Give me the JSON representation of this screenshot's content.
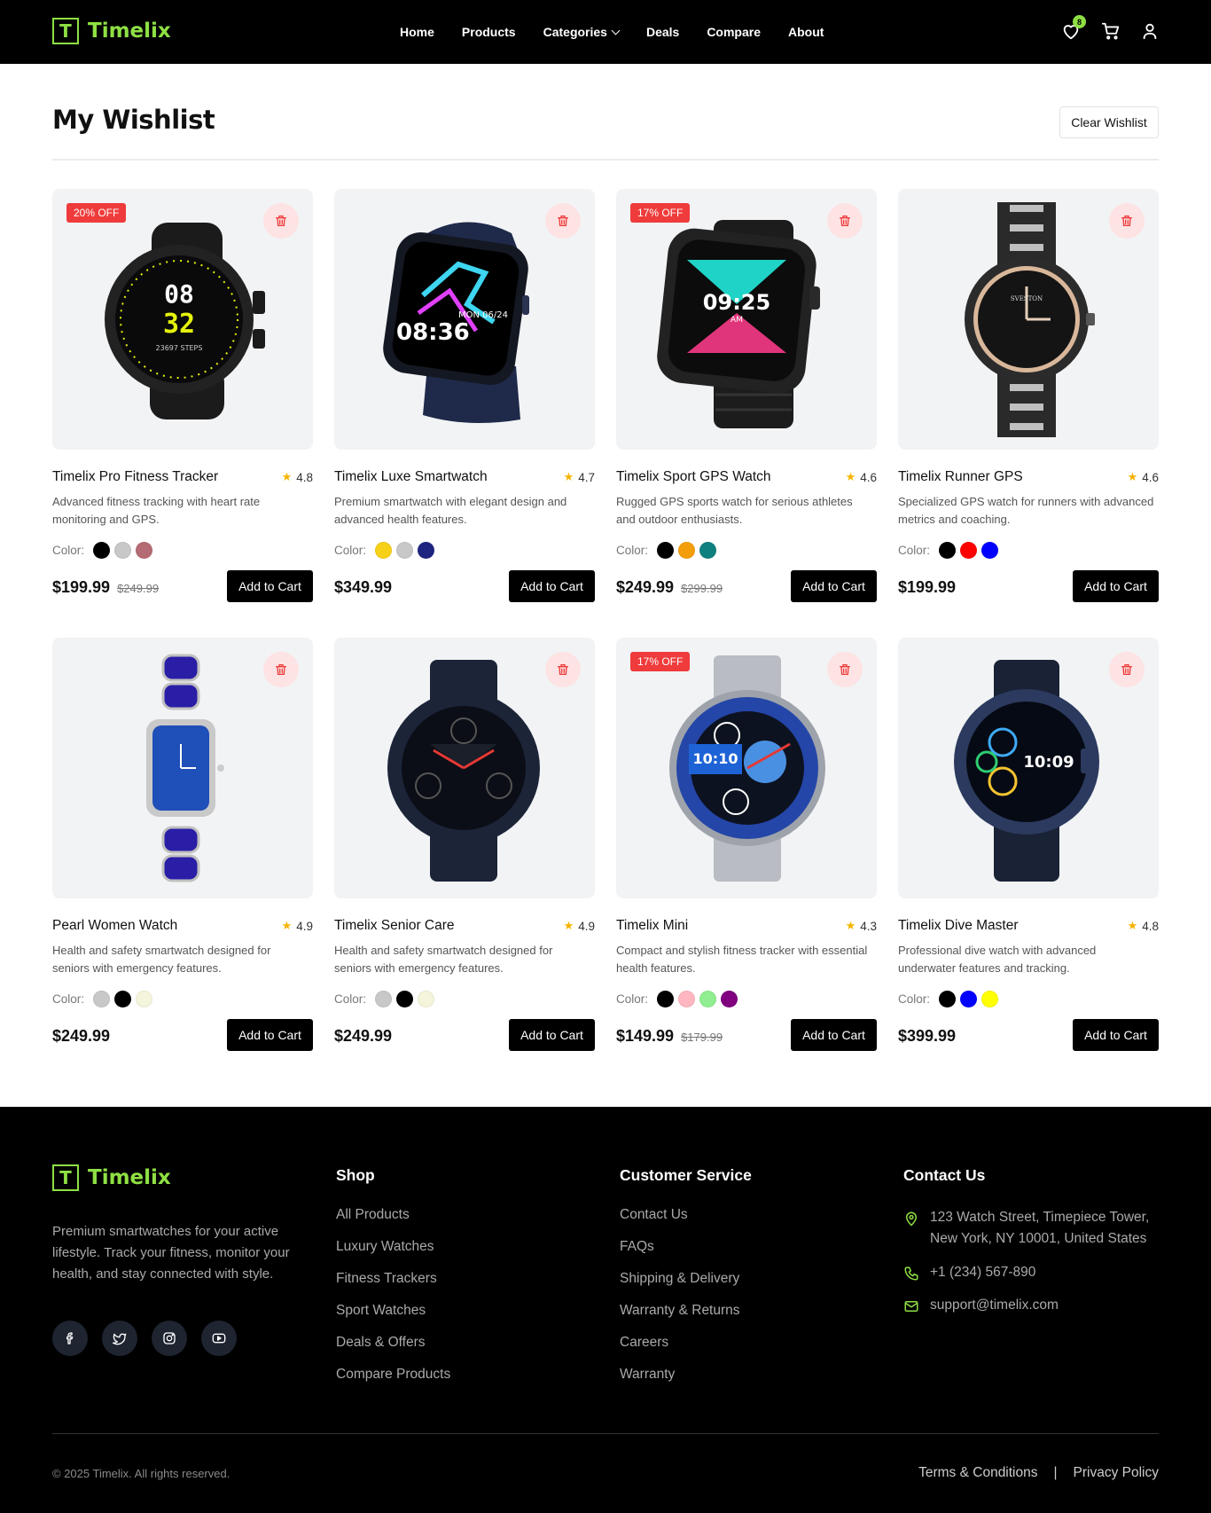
{
  "brand": {
    "logo_letter": "T",
    "name": "Timelix"
  },
  "nav": {
    "items": [
      "Home",
      "Products",
      "Categories",
      "Deals",
      "Compare",
      "About"
    ],
    "wishlist_count": "8"
  },
  "wishlist": {
    "title": "My Wishlist",
    "clear_label": "Clear Wishlist",
    "color_label": "Color:",
    "add_to_cart_label": "Add to Cart",
    "products": [
      {
        "name": "Timelix Pro Fitness Tracker",
        "rating": "4.8",
        "description": "Advanced fitness tracking with heart rate monitoring and GPS.",
        "price": "$199.99",
        "old_price": "$249.99",
        "discount": "20% OFF",
        "colors": [
          "#000000",
          "#c8c8c8",
          "#b56b73"
        ],
        "image": "round-black-sport-watch"
      },
      {
        "name": "Timelix Luxe Smartwatch",
        "rating": "4.7",
        "description": "Premium smartwatch with elegant design and advanced health features.",
        "price": "$349.99",
        "old_price": "",
        "discount": "",
        "colors": [
          "#f7d117",
          "#c8c8c8",
          "#1e2580"
        ],
        "image": "square-navy-smartwatch"
      },
      {
        "name": "Timelix Sport GPS Watch",
        "rating": "4.6",
        "description": "Rugged GPS sports watch for serious athletes and outdoor enthusiasts.",
        "price": "$249.99",
        "old_price": "$299.99",
        "discount": "17% OFF",
        "colors": [
          "#000000",
          "#f59e0b",
          "#0f8080"
        ],
        "image": "square-black-rugged-watch"
      },
      {
        "name": "Timelix Runner GPS",
        "rating": "4.6",
        "description": "Specialized GPS watch for runners with advanced metrics and coaching.",
        "price": "$199.99",
        "old_price": "",
        "discount": "",
        "colors": [
          "#000000",
          "#ff0000",
          "#0000ff"
        ],
        "image": "analog-black-steel-watch"
      },
      {
        "name": "Pearl Women Watch",
        "rating": "4.9",
        "description": "Health and safety smartwatch designed for seniors with emergency features.",
        "price": "$249.99",
        "old_price": "",
        "discount": "",
        "colors": [
          "#c8c8c8",
          "#000000",
          "#f5f5dc"
        ],
        "image": "blue-gem-ladies-watch"
      },
      {
        "name": "Timelix Senior Care",
        "rating": "4.9",
        "description": "Health and safety smartwatch designed for seniors with emergency features.",
        "price": "$249.99",
        "old_price": "",
        "discount": "",
        "colors": [
          "#c8c8c8",
          "#000000",
          "#f5f5dc"
        ],
        "image": "navy-round-smartwatch"
      },
      {
        "name": "Timelix Mini",
        "rating": "4.3",
        "description": "Compact and stylish fitness tracker with essential health features.",
        "price": "$149.99",
        "old_price": "$179.99",
        "discount": "17% OFF",
        "colors": [
          "#000000",
          "#ffb6c1",
          "#90ee90",
          "#800080"
        ],
        "image": "blue-steel-gear-watch"
      },
      {
        "name": "Timelix Dive Master",
        "rating": "4.8",
        "description": "Professional dive watch with advanced underwater features and tracking.",
        "price": "$399.99",
        "old_price": "",
        "discount": "",
        "colors": [
          "#000000",
          "#0000ff",
          "#ffff00"
        ],
        "image": "blue-dive-smartwatch"
      }
    ]
  },
  "footer": {
    "about": "Premium smartwatches for your active lifestyle. Track your fitness, monitor your health, and stay connected with style.",
    "socials": [
      "facebook-icon",
      "twitter-icon",
      "instagram-icon",
      "youtube-icon"
    ],
    "shop": {
      "title": "Shop",
      "links": [
        "All Products",
        "Luxury Watches",
        "Fitness Trackers",
        "Sport Watches",
        "Deals & Offers",
        "Compare Products"
      ]
    },
    "service": {
      "title": "Customer Service",
      "links": [
        "Contact Us",
        "FAQs",
        "Shipping & Delivery",
        "Warranty & Returns",
        "Careers",
        "Warranty"
      ]
    },
    "contact": {
      "title": "Contact Us",
      "address": "123 Watch Street, Timepiece Tower, New York, NY 10001, United States",
      "phone": "+1 (234) 567-890",
      "email": "support@timelix.com"
    },
    "copyright": "© 2025 Timelix. All rights reserved.",
    "terms": "Terms & Conditions",
    "separator": "|",
    "privacy": "Privacy Policy"
  },
  "colors": {
    "accent": "#8ee043",
    "discount": "#ef3b3b",
    "header_bg": "#000000"
  }
}
